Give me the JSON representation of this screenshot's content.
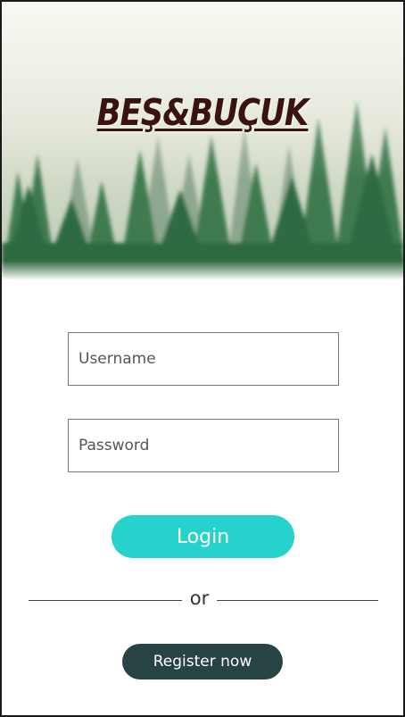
{
  "header": {
    "brand_title": "BEŞ&BUÇUK",
    "background": "misty-forest-image"
  },
  "login_form": {
    "username_placeholder": "Username",
    "password_placeholder": "Password",
    "login_label": "Login"
  },
  "divider": {
    "text": "or"
  },
  "register": {
    "label": "Register now"
  },
  "colors": {
    "login_button": "#26d3cc",
    "register_button": "#284343",
    "brand_text": "#3a1212"
  }
}
